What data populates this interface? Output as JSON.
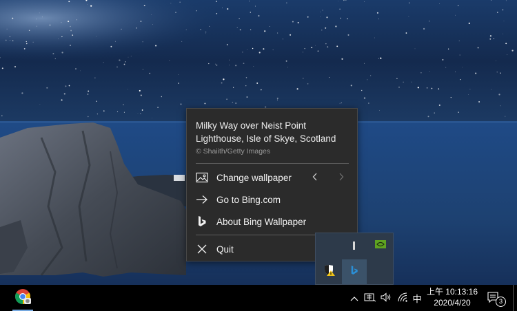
{
  "menu": {
    "title": "Milky Way over Neist Point Lighthouse, Isle of Skye, Scotland",
    "copyright": "© Shaiith/Getty Images",
    "items": [
      {
        "label": "Change wallpaper",
        "icon": "image-icon"
      },
      {
        "label": "Go to Bing.com",
        "icon": "arrow-right-icon"
      },
      {
        "label": "About Bing Wallpaper",
        "icon": "bing-logo-icon"
      },
      {
        "label": "Quit",
        "icon": "close-icon"
      }
    ],
    "prev_icon": "chevron-left-icon",
    "next_icon": "chevron-right-icon"
  },
  "tray_flyout": {
    "icons": [
      "nvidia-icon",
      "security-warning-icon",
      "bing-wallpaper-icon"
    ]
  },
  "taskbar": {
    "pinned": [
      {
        "name": "Google Chrome",
        "icon": "chrome-icon"
      }
    ],
    "tray": {
      "show_hidden_icon": "chevron-up-icon",
      "icons": [
        "ime-mode-icon",
        "volume-icon",
        "wifi-icon"
      ],
      "input_language": "中"
    },
    "clock": {
      "time": "上午 10:13:16",
      "date": "2020/4/20"
    },
    "notifications": {
      "count": "3",
      "icon": "action-center-icon"
    }
  },
  "colors": {
    "menu_bg": "#2b2b2b",
    "menu_text": "#f2f2f2",
    "taskbar_bg": "#000000",
    "flyout_bg": "#2d3a4a",
    "bing_accent": "#2b8fd6"
  }
}
